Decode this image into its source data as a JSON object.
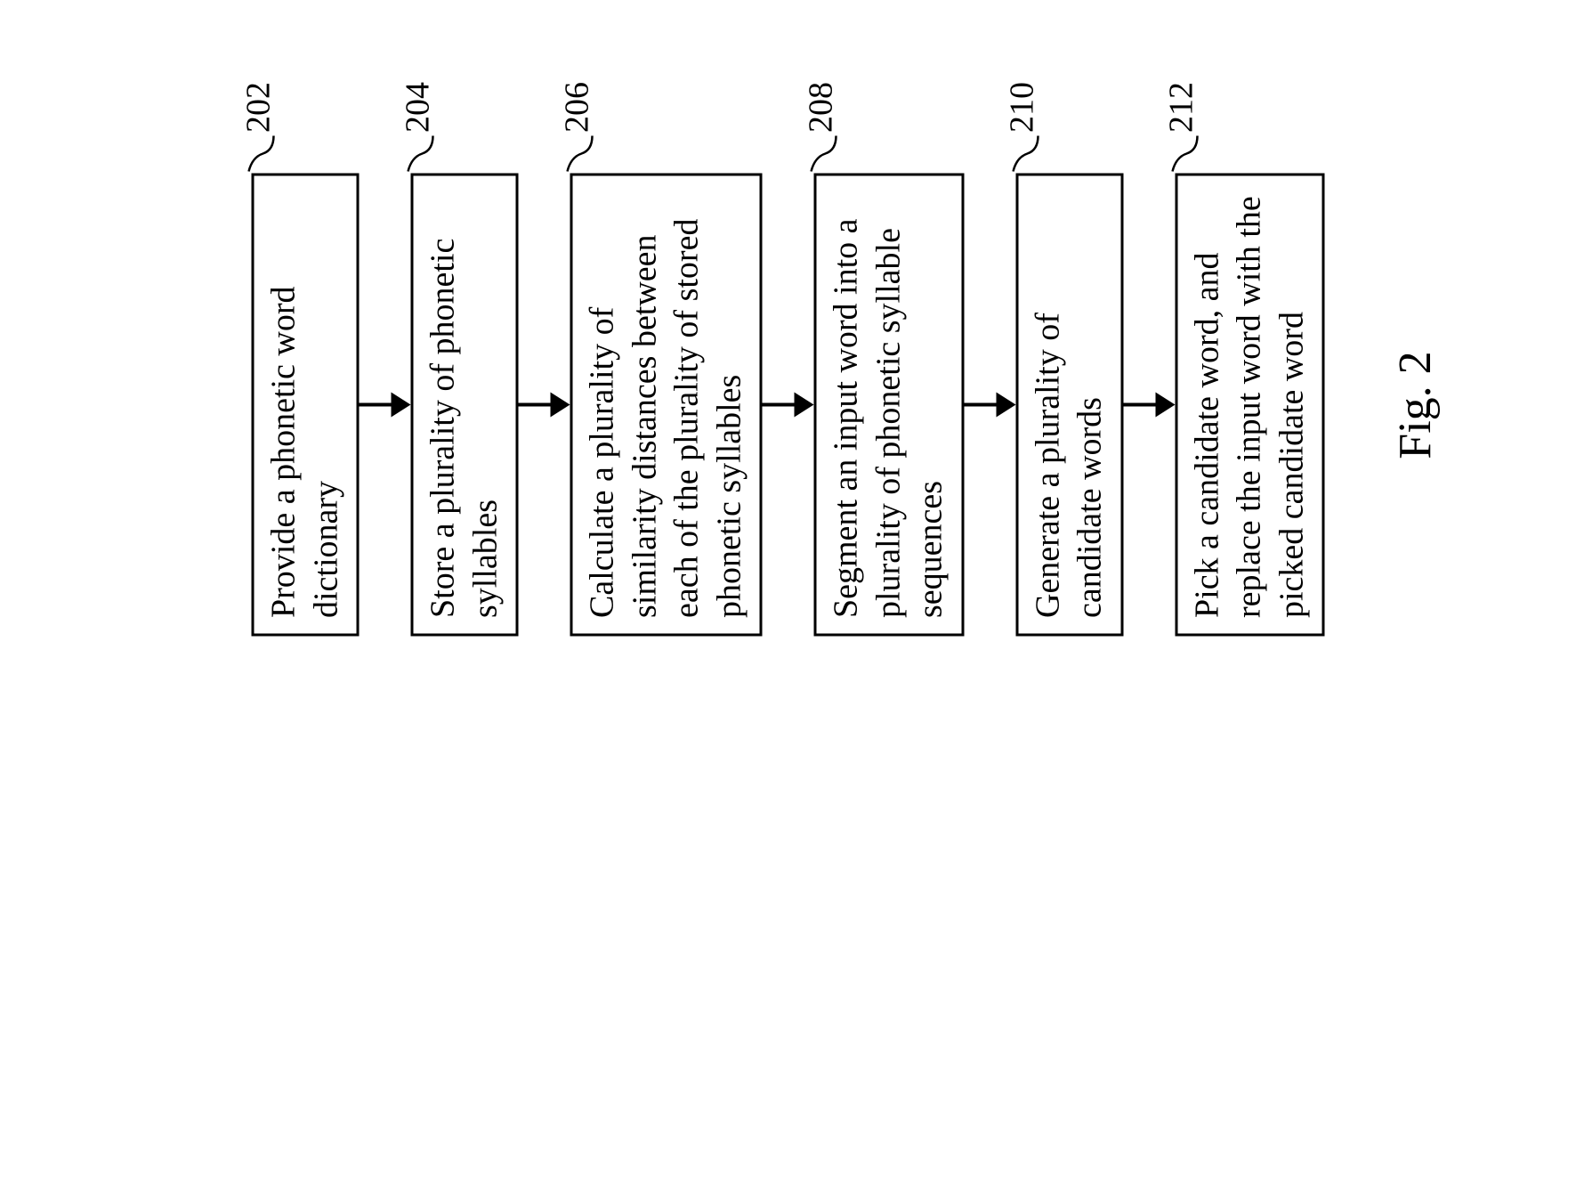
{
  "chart_data": {
    "type": "flowchart",
    "title": "Fig. 2",
    "direction": "vertical",
    "steps": [
      {
        "id": "202",
        "text": "Provide a phonetic word dictionary"
      },
      {
        "id": "204",
        "text": "Store a plurality of phonetic syllables"
      },
      {
        "id": "206",
        "text": "Calculate a plurality of similarity distances between each of the plurality of stored phonetic syllables"
      },
      {
        "id": "208",
        "text": "Segment an input word into a plurality of phonetic syllable sequences"
      },
      {
        "id": "210",
        "text": "Generate a plurality of candidate words"
      },
      {
        "id": "212",
        "text": "Pick a candidate word, and replace the input word with the picked candidate word"
      }
    ]
  },
  "figure_caption": "Fig. 2"
}
